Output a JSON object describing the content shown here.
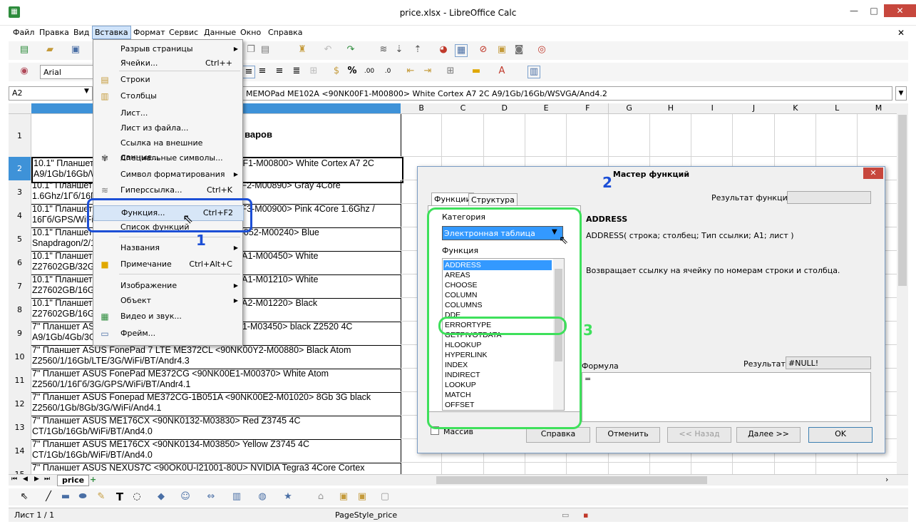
{
  "window": {
    "title": "price.xlsx - LibreOffice Calc",
    "minimize": "—",
    "maximize": "□",
    "close": "✕"
  },
  "menu": {
    "items": [
      "Файл",
      "Правка",
      "Вид",
      "Вставка",
      "Формат",
      "Сервис",
      "Данные",
      "Окно",
      "Справка"
    ],
    "close_doc": "✕"
  },
  "toolbar": {
    "font_name": "Arial"
  },
  "formula_bar": {
    "cell_ref": "A2",
    "content": "MEMOPad ME102A <90NK00F1-M00800> White Cortex A7 2C A9/1Gb/16Gb/WSVGA/And4.2"
  },
  "grid": {
    "columns": [
      "B",
      "C",
      "D",
      "E",
      "F",
      "G",
      "H",
      "I",
      "J",
      "K",
      "L",
      "M"
    ],
    "header_cell": "варов",
    "rows": [
      {
        "num": "1",
        "text": ""
      },
      {
        "num": "2",
        "text": "10.1\" Планшет ASUS MEMOPad ME102A <90NK00F1-M00800> White Cortex A7 2C A9/1Gb/16Gb/WSVGA/And4.2"
      },
      {
        "num": "3",
        "text": "10.1\" Планшет ASUS MEMOPad ME102A <90NK00F2-M00890> Gray 4Core 1.6Ghz/1Гб/16Гб/WiFi/BT/And4.4"
      },
      {
        "num": "4",
        "text": "10.1\" Планшет ASUS MEMOPad ME102A <90NK00F3-M00900> Pink 4Core 1.6Ghz / 16Гб/GPS/WiFi/BT/And4.4"
      },
      {
        "num": "5",
        "text": "10.1\" Планшет ASUS Transformer TF103CL <90NK0052-M00240> Blue Snapdragon/2/16Gb/LTE/And4.4"
      },
      {
        "num": "6",
        "text": "10.1\" Планшет ASUS MEMOPad ME103K <90NK00A1-M00450> White Z27602GB/32Gb/GPS/WiFi/BT/Andr4.4"
      },
      {
        "num": "7",
        "text": "10.1\" Планшет ASUS MEMOPad ME103K <90NK00A1-M01210> White Z27602GB/16Gb/GPS/WiFi/BT/Andr4.4"
      },
      {
        "num": "8",
        "text": "10.1\" Планшет ASUS MEMOPad ME103K <90NK00A2-M01220> Black Z27602GB/16Gb/GPS/WiFi/BT/Andr4.4"
      },
      {
        "num": "9",
        "text": "7\" Планшет ASUS FonePad 7 FE170CG <90NK00M1-M03450> black Z2520 4C A9/1Gb/4Gb/3G/WiFi/BT/Andr4.3"
      },
      {
        "num": "10",
        "text": "7\" Планшет ASUS FonePad 7 LTE ME372CL <90NK00Y2-M00880> Black Atom Z2560/1/16Gb/LTE/3G/WiFi/BT/Andr4.3"
      },
      {
        "num": "11",
        "text": "7\" Планшет ASUS FonePad ME372CG <90NK00E1-M00370> White Atom Z2560/1/16Гб/3G/GPS/WiFi/BT/Andr4.1"
      },
      {
        "num": "12",
        "text": "7\" Планшет ASUS Fonepad ME372CG-1B051A <90NK00E2-M01020> 8Gb 3G black Z2560/1Gb/8Gb/3G/WiFi/And4.1"
      },
      {
        "num": "13",
        "text": "7\" Планшет ASUS ME176CX <90NK0132-M03830> Red Z3745 4C CT/1Gb/16Gb/WiFi/BT/And4.0"
      },
      {
        "num": "14",
        "text": "7\" Планшет ASUS ME176CX <90NK0134-M03850> Yellow Z3745 4C CT/1Gb/16Gb/WiFi/BT/And4.0"
      },
      {
        "num": "15",
        "text": "7\" Планшет ASUS NEXUS7C <90OK0U-I21001-80U> NVIDIA Tegra3 4Core Cortex"
      }
    ]
  },
  "insert_menu": {
    "items": [
      {
        "label": "Разрыв страницы",
        "shortcut": "",
        "submenu": true
      },
      {
        "label": "Ячейки...",
        "shortcut": "Ctrl++",
        "submenu": false
      },
      {
        "label": "Строки",
        "shortcut": "",
        "submenu": false
      },
      {
        "label": "Столбцы",
        "shortcut": "",
        "submenu": false
      },
      {
        "label": "Лист...",
        "shortcut": "",
        "submenu": false
      },
      {
        "label": "Лист из файла...",
        "shortcut": "",
        "submenu": false
      },
      {
        "label": "Ссылка на внешние данные...",
        "shortcut": "",
        "submenu": false
      },
      {
        "label": "Специальные символы...",
        "shortcut": "",
        "submenu": false
      },
      {
        "label": "Символ форматирования",
        "shortcut": "",
        "submenu": true
      },
      {
        "label": "Гиперссылка...",
        "shortcut": "Ctrl+K",
        "submenu": false
      },
      {
        "label": "Функция...",
        "shortcut": "Ctrl+F2",
        "submenu": false
      },
      {
        "label": "Список функций",
        "shortcut": "",
        "submenu": false
      },
      {
        "label": "Названия",
        "shortcut": "",
        "submenu": true
      },
      {
        "label": "Примечание",
        "shortcut": "Ctrl+Alt+C",
        "submenu": false
      },
      {
        "label": "Изображение",
        "shortcut": "",
        "submenu": true
      },
      {
        "label": "Объект",
        "shortcut": "",
        "submenu": true
      },
      {
        "label": "Видео и звук...",
        "shortcut": "",
        "submenu": false
      },
      {
        "label": "Фрейм...",
        "shortcut": "",
        "submenu": false
      }
    ]
  },
  "dialog": {
    "title": "Мастер функций",
    "tabs": [
      "Функции",
      "Структура"
    ],
    "result_label": "Результат функции",
    "category_label": "Категория",
    "category_value": "Электронная таблица",
    "function_label": "Функция",
    "functions": [
      "ADDRESS",
      "AREAS",
      "CHOOSE",
      "COLUMN",
      "COLUMNS",
      "DDE",
      "ERRORTYPE",
      "GETPIVOTDATA",
      "HLOOKUP",
      "HYPERLINK",
      "INDEX",
      "INDIRECT",
      "LOOKUP",
      "MATCH",
      "OFFSET"
    ],
    "selected_function": "ADDRESS",
    "func_name": "ADDRESS",
    "func_signature": "ADDRESS( строка; столбец; Тип ссылки; A1; лист )",
    "func_description": "Возвращает ссылку на ячейку по номерам строки и столбца.",
    "formula_label": "Формула",
    "result2_label": "Результат",
    "result2_value": "#NULL!",
    "formula_value": "=",
    "array_label": "Массив",
    "buttons": {
      "help": "Справка",
      "cancel": "Отменить",
      "back": "<< Назад",
      "next": "Далее >>",
      "ok": "OK"
    }
  },
  "annotations": {
    "n1": "1",
    "n2": "2",
    "n3": "3"
  },
  "sheet_tabs": {
    "active": "price",
    "add": "+"
  },
  "status": {
    "sheet": "Лист 1 / 1",
    "page_style": "PageStyle_price"
  }
}
